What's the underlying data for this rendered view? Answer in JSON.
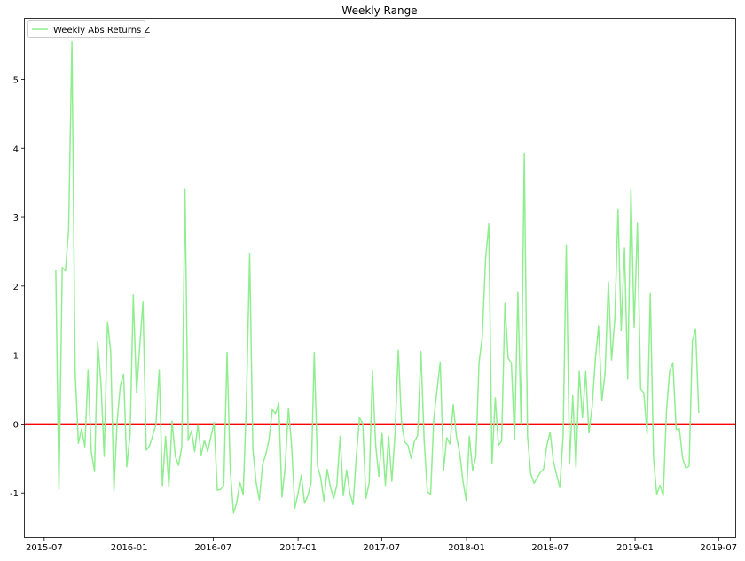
{
  "chart_data": {
    "type": "line",
    "title": "Weekly Range",
    "xlabel": "",
    "ylabel": "",
    "x_start": "2015-07-26",
    "x_step_days": 7,
    "xlim": [
      "2015-05-20",
      "2019-08-06"
    ],
    "ylim": [
      -1.64,
      5.88
    ],
    "x_ticks": [
      "2015-07",
      "2016-01",
      "2016-07",
      "2017-01",
      "2017-07",
      "2018-01",
      "2018-07",
      "2019-01",
      "2019-07"
    ],
    "y_ticks": [
      -1,
      0,
      1,
      2,
      3,
      4,
      5
    ],
    "grid": false,
    "legend": {
      "position": "top-left",
      "entries": [
        "Weekly Abs Returns Z"
      ]
    },
    "hline": {
      "y": 0,
      "color": "#ff0000"
    },
    "series": [
      {
        "name": "Weekly Abs Returns Z",
        "color": "#90ee90",
        "values": [
          2.23,
          -0.95,
          2.27,
          2.22,
          2.82,
          5.55,
          0.77,
          -0.28,
          -0.07,
          -0.33,
          0.79,
          -0.4,
          -0.69,
          1.19,
          0.58,
          -0.47,
          1.48,
          1.06,
          -0.97,
          0.04,
          0.56,
          0.72,
          -0.62,
          -0.15,
          1.87,
          0.45,
          1.13,
          1.77,
          -0.38,
          -0.32,
          -0.17,
          -0.01,
          0.79,
          -0.89,
          -0.18,
          -0.91,
          0.04,
          -0.47,
          -0.6,
          -0.33,
          3.41,
          -0.24,
          -0.1,
          -0.4,
          -0.01,
          -0.45,
          -0.24,
          -0.4,
          -0.19,
          0.02,
          -0.96,
          -0.95,
          -0.89,
          1.04,
          -0.66,
          -1.29,
          -1.14,
          -0.85,
          -1.02,
          0.3,
          2.47,
          -0.36,
          -0.85,
          -1.1,
          -0.59,
          -0.44,
          -0.23,
          0.21,
          0.15,
          0.3,
          -1.06,
          -0.63,
          0.23,
          -0.31,
          -1.22,
          -1.0,
          -0.74,
          -1.15,
          -1.04,
          -0.86,
          1.04,
          -0.61,
          -0.78,
          -1.12,
          -0.66,
          -0.91,
          -1.08,
          -0.89,
          -0.18,
          -1.04,
          -0.67,
          -1.0,
          -1.17,
          -0.48,
          0.09,
          0.01,
          -1.08,
          -0.85,
          0.77,
          -0.31,
          -0.76,
          -0.14,
          -0.89,
          -0.18,
          -0.83,
          -0.14,
          1.07,
          0.03,
          -0.26,
          -0.31,
          -0.5,
          -0.25,
          -0.17,
          1.05,
          -0.23,
          -0.98,
          -1.02,
          0.07,
          0.5,
          0.9,
          -0.67,
          -0.2,
          -0.29,
          0.28,
          -0.18,
          -0.42,
          -0.82,
          -1.11,
          -0.18,
          -0.67,
          -0.48,
          0.89,
          1.27,
          2.38,
          2.9,
          -0.58,
          0.38,
          -0.31,
          -0.25,
          1.75,
          0.96,
          0.88,
          -0.23,
          1.92,
          0.01,
          3.92,
          -0.18,
          -0.72,
          -0.86,
          -0.78,
          -0.7,
          -0.65,
          -0.31,
          -0.12,
          -0.53,
          -0.74,
          -0.92,
          -0.18,
          2.6,
          -0.58,
          0.41,
          -0.63,
          0.76,
          0.09,
          0.76,
          -0.13,
          0.26,
          0.95,
          1.42,
          0.34,
          0.74,
          2.06,
          0.93,
          1.52,
          3.11,
          1.35,
          2.55,
          0.65,
          3.41,
          1.4,
          2.91,
          0.51,
          0.45,
          -0.14,
          1.89,
          -0.5,
          -1.02,
          -0.89,
          -1.04,
          0.2,
          0.78,
          0.88,
          -0.08,
          -0.07,
          -0.5,
          -0.64,
          -0.61,
          1.2,
          1.38,
          0.16
        ]
      }
    ]
  }
}
